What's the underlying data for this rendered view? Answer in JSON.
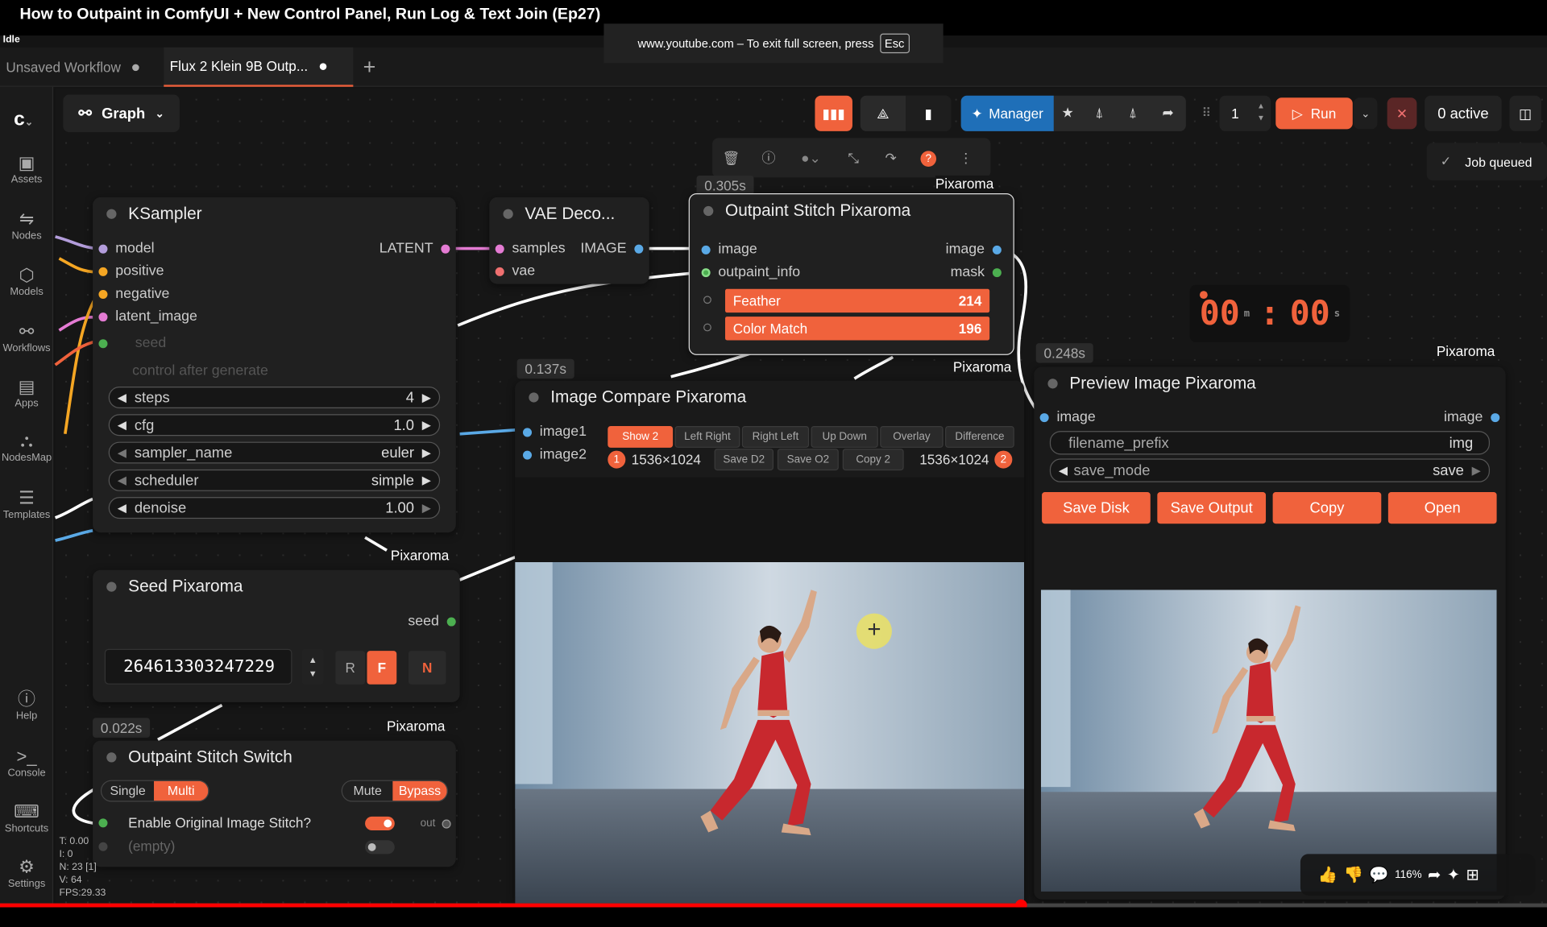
{
  "window": {
    "title": "How to Outpaint in ComfyUI + New Control Panel, Run Log & Text Join (Ep27)",
    "status": "Idle"
  },
  "fullscreen_notice": {
    "text": "www.youtube.com – To exit full screen, press",
    "key": "Esc"
  },
  "tabs": [
    {
      "label": "Unsaved Workflow"
    },
    {
      "label": "Flux 2 Klein 9B Outp..."
    }
  ],
  "sidebar": {
    "items": [
      {
        "label": "Assets"
      },
      {
        "label": "Nodes"
      },
      {
        "label": "Models"
      },
      {
        "label": "Workflows"
      },
      {
        "label": "Apps"
      },
      {
        "label": "NodesMap"
      },
      {
        "label": "Templates"
      },
      {
        "label": "Help"
      },
      {
        "label": "Console"
      },
      {
        "label": "Shortcuts"
      },
      {
        "label": "Settings"
      }
    ]
  },
  "toolbar": {
    "graph_label": "Graph",
    "manager_label": "Manager",
    "batch_count": "1",
    "run_label": "Run",
    "active_label": "0 active"
  },
  "notification": {
    "text": "Job queued"
  },
  "timer": {
    "minutes": "00",
    "seconds": "00",
    "m_unit": "m",
    "s_unit": "s"
  },
  "ksampler": {
    "title": "KSampler",
    "inputs": [
      "model",
      "positive",
      "negative",
      "latent_image"
    ],
    "output": "LATENT",
    "seed_label": "seed",
    "control_label": "control after generate",
    "widgets": [
      {
        "name": "steps",
        "value": "4"
      },
      {
        "name": "cfg",
        "value": "1.0"
      },
      {
        "name": "sampler_name",
        "value": "euler"
      },
      {
        "name": "scheduler",
        "value": "simple"
      },
      {
        "name": "denoise",
        "value": "1.00"
      }
    ]
  },
  "vae_decode": {
    "title": "VAE Deco...",
    "inputs": [
      "samples",
      "vae"
    ],
    "output": "IMAGE"
  },
  "outpaint_stitch": {
    "title": "Outpaint Stitch Pixaroma",
    "timing": "0.305s",
    "badge": "Pixaroma",
    "inputs": [
      "image",
      "outpaint_info"
    ],
    "outputs": [
      "image",
      "mask"
    ],
    "feather_label": "Feather",
    "feather_value": "214",
    "color_match_label": "Color Match",
    "color_match_value": "196",
    "bottom_badge": "Pixaroma"
  },
  "image_compare": {
    "title": "Image Compare Pixaroma",
    "timing": "0.137s",
    "inputs": [
      "image1",
      "image2"
    ],
    "modes": [
      "Show 2",
      "Left Right",
      "Right Left",
      "Up Down",
      "Overlay",
      "Difference"
    ],
    "actions": [
      "Save D2",
      "Save O2",
      "Copy 2"
    ],
    "size1": "1536×1024",
    "size2": "1536×1024",
    "marker1": "1",
    "marker2": "2"
  },
  "preview_image": {
    "title": "Preview Image Pixaroma",
    "timing": "0.248s",
    "badge": "Pixaroma",
    "input": "image",
    "output": "image",
    "filename_label": "filename_prefix",
    "filename_value": "img",
    "save_mode_label": "save_mode",
    "save_mode_value": "save",
    "buttons": [
      "Save Disk",
      "Save Output",
      "Copy",
      "Open"
    ]
  },
  "seed_node": {
    "title": "Seed Pixaroma",
    "badge_above": "Pixaroma",
    "output": "seed",
    "value": "264613303247229",
    "btn_r": "R",
    "btn_f": "F",
    "btn_n": "N",
    "badge_below": "Pixaroma"
  },
  "switch_node": {
    "title": "Outpaint Stitch Switch",
    "timing": "0.022s",
    "single": "Single",
    "multi": "Multi",
    "mute": "Mute",
    "bypass": "Bypass",
    "enable_label": "Enable Original Image Stitch?",
    "empty_label": "(empty)",
    "out_label": "out"
  },
  "stats": {
    "t": "T: 0.00",
    "i": "I: 0",
    "n": "N: 23 [1]",
    "v": "V: 64",
    "fps": "FPS:29.33"
  },
  "video": {
    "progress": 0.66,
    "zoom_label": "116%"
  },
  "colors": {
    "accent": "#f0623c",
    "manager": "#1f6fb8",
    "canvas": "#161616"
  }
}
